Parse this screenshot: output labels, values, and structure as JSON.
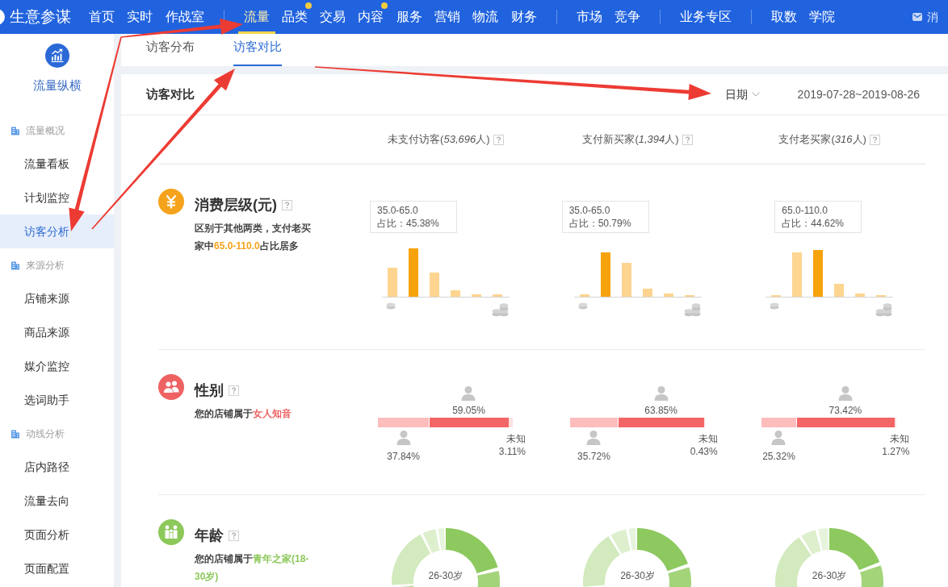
{
  "top_nav": {
    "brand": "生意参谋",
    "groups": [
      {
        "items": [
          {
            "label": "首页",
            "selected": false,
            "notification_dot": false
          },
          {
            "label": "实时",
            "selected": false,
            "notification_dot": false
          },
          {
            "label": "作战室",
            "selected": false,
            "notification_dot": false
          }
        ]
      },
      {
        "items": [
          {
            "label": "流量",
            "selected": true,
            "notification_dot": false
          },
          {
            "label": "品类",
            "selected": false,
            "notification_dot": true
          },
          {
            "label": "交易",
            "selected": false,
            "notification_dot": false
          },
          {
            "label": "内容",
            "selected": false,
            "notification_dot": true
          },
          {
            "label": "服务",
            "selected": false,
            "notification_dot": false
          },
          {
            "label": "营销",
            "selected": false,
            "notification_dot": false
          },
          {
            "label": "物流",
            "selected": false,
            "notification_dot": false
          },
          {
            "label": "财务",
            "selected": false,
            "notification_dot": false
          }
        ]
      },
      {
        "items": [
          {
            "label": "市场",
            "selected": false,
            "notification_dot": false
          },
          {
            "label": "竞争",
            "selected": false,
            "notification_dot": false
          }
        ]
      },
      {
        "items": [
          {
            "label": "业务专区",
            "selected": false,
            "notification_dot": false
          }
        ]
      },
      {
        "items": [
          {
            "label": "取数",
            "selected": false,
            "notification_dot": false
          },
          {
            "label": "学院",
            "selected": false,
            "notification_dot": false
          }
        ]
      }
    ],
    "messages": "消"
  },
  "sidebar": {
    "title": "流量纵横",
    "sections": [
      {
        "heading": "流量概况",
        "items": [
          {
            "label": "流量看板",
            "selected": false
          },
          {
            "label": "计划监控",
            "selected": false
          },
          {
            "label": "访客分析",
            "selected": true
          }
        ]
      },
      {
        "heading": "来源分析",
        "items": [
          {
            "label": "店铺来源",
            "selected": false
          },
          {
            "label": "商品来源",
            "selected": false
          },
          {
            "label": "媒介监控",
            "selected": false
          },
          {
            "label": "选词助手",
            "selected": false
          }
        ]
      },
      {
        "heading": "动线分析",
        "items": [
          {
            "label": "店内路径",
            "selected": false
          },
          {
            "label": "流量去向",
            "selected": false
          },
          {
            "label": "页面分析",
            "selected": false
          },
          {
            "label": "页面配置",
            "selected": false
          }
        ]
      }
    ]
  },
  "tabs": [
    {
      "label": "访客分布",
      "selected": false
    },
    {
      "label": "访客对比",
      "selected": true
    }
  ],
  "panel": {
    "title": "访客对比",
    "date_filter": "日期",
    "date_range": "2019-07-28~2019-08-26",
    "columns": [
      {
        "before": "未支付访客(",
        "count": "53,696",
        "after": "人)"
      },
      {
        "before": "支付新买家(",
        "count": "1,394",
        "after": "人)"
      },
      {
        "before": "支付老买家(",
        "count": "316",
        "after": "人)"
      }
    ],
    "sections": [
      {
        "kind": "spending",
        "title": "消费层级(元)",
        "color": "#f5a31c",
        "description": {
          "before": "区别于其他两类，支付老买家中",
          "highlight": "65.0-110.0",
          "after": "占比居多"
        },
        "columns": [
          {
            "bars": [
              {
                "selected": false
              },
              {
                "selected": true
              },
              {
                "selected": false
              },
              {
                "selected": false
              },
              {
                "selected": false
              },
              {
                "selected": false
              }
            ],
            "tooltip": {
              "range": "35.0-65.0",
              "share": "占比：45.38%"
            }
          },
          {
            "bars": [
              {
                "selected": false
              },
              {
                "selected": true
              },
              {
                "selected": false
              },
              {
                "selected": false
              },
              {
                "selected": false
              },
              {
                "selected": false
              }
            ],
            "tooltip": {
              "range": "35.0-65.0",
              "share": "占比：50.79%"
            }
          },
          {
            "bars": [
              {
                "selected": false
              },
              {
                "selected": false
              },
              {
                "selected": true
              },
              {
                "selected": false
              },
              {
                "selected": false
              },
              {
                "selected": false
              }
            ],
            "tooltip": {
              "range": "65.0-110.0",
              "share": "占比：44.62%"
            }
          }
        ]
      },
      {
        "kind": "gender",
        "title": "性别",
        "color": "#ef6262",
        "description": {
          "before": "您的店铺属于",
          "highlight": "女人知音"
        },
        "columns": [
          {
            "segments": [
              {
                "reading": "37.84%",
                "level": 0.3784
              },
              {
                "reading": "59.05%",
                "level": 0.5905
              },
              {
                "label": "未知",
                "reading": "3.11%",
                "level": 0.0311
              }
            ]
          },
          {
            "segments": [
              {
                "reading": "35.72%",
                "level": 0.3572
              },
              {
                "reading": "63.85%",
                "level": 0.6385
              },
              {
                "label": "未知",
                "reading": "0.43%",
                "level": 0.0043
              }
            ]
          },
          {
            "segments": [
              {
                "reading": "25.32%",
                "level": 0.2532
              },
              {
                "reading": "73.42%",
                "level": 0.7342
              },
              {
                "label": "未知",
                "reading": "1.27%",
                "level": 0.0127
              }
            ]
          }
        ]
      },
      {
        "kind": "age",
        "title": "年龄",
        "color": "#8cc85a",
        "description": {
          "before": "您的店铺属于",
          "highlight": "青年之家(18-30岁)"
        },
        "columns": [
          {
            "center_label": "26-30岁"
          },
          {
            "center_label": "26-30岁"
          },
          {
            "center_label": "26-30岁"
          }
        ]
      }
    ]
  }
}
